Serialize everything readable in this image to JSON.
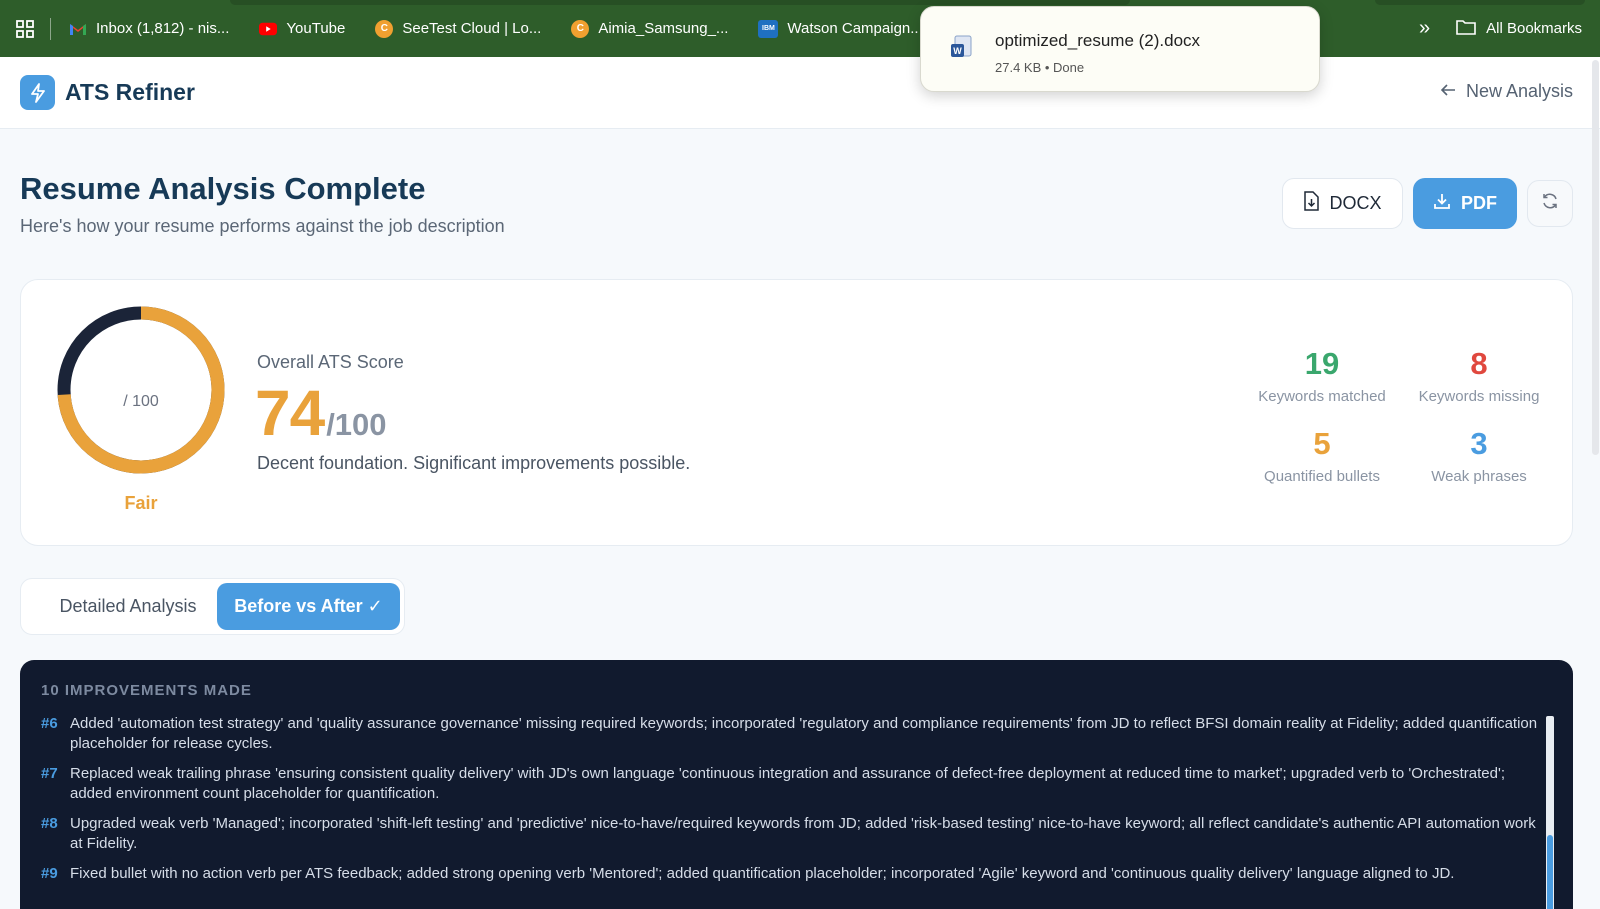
{
  "bookmarks": {
    "items": [
      {
        "label": "Inbox (1,812) - nis...",
        "icon": "gmail-icon",
        "color": "#ea4335"
      },
      {
        "label": "YouTube",
        "icon": "youtube-icon",
        "color": "#ff0000"
      },
      {
        "label": "SeeTest Cloud | Lo...",
        "icon": "seetest-icon",
        "color": "#f0a030"
      },
      {
        "label": "Aimia_Samsung_...",
        "icon": "aimia-icon",
        "color": "#f0a030"
      },
      {
        "label": "Watson Campaign...",
        "icon": "ibm-icon",
        "color": "#1f70c1"
      }
    ],
    "all_bookmarks": "All Bookmarks"
  },
  "download": {
    "filename": "optimized_resume (2).docx",
    "meta": "27.4 KB • Done"
  },
  "app": {
    "brand": "ATS Refiner",
    "new_analysis": "New Analysis"
  },
  "header": {
    "title": "Resume Analysis Complete",
    "subtitle": "Here's how your resume performs against the job description"
  },
  "actions": {
    "docx": "DOCX",
    "pdf": "PDF"
  },
  "score": {
    "label": "Overall ATS Score",
    "value": "74",
    "max": "/100",
    "fraction": 0.74,
    "gauge_center": "/ 100",
    "rating": "Fair",
    "description": "Decent foundation. Significant improvements possible.",
    "accent": "#e9a23b"
  },
  "stats": [
    {
      "value": "19",
      "label": "Keywords matched",
      "color": "#3aa76d"
    },
    {
      "value": "8",
      "label": "Keywords missing",
      "color": "#e0483e"
    },
    {
      "value": "5",
      "label": "Quantified bullets",
      "color": "#e9a23b"
    },
    {
      "value": "3",
      "label": "Weak phrases",
      "color": "#4a9ce0"
    }
  ],
  "tabs": {
    "detailed": "Detailed Analysis",
    "before_after": "Before vs After ✓"
  },
  "improvements": {
    "title": "10 IMPROVEMENTS MADE",
    "items": [
      {
        "index": "#6",
        "text": "Added 'automation test strategy' and 'quality assurance governance' missing required keywords; incorporated 'regulatory and compliance requirements' from JD to reflect BFSI domain reality at Fidelity; added quantification placeholder for release cycles."
      },
      {
        "index": "#7",
        "text": "Replaced weak trailing phrase 'ensuring consistent quality delivery' with JD's own language 'continuous integration and assurance of defect-free deployment at reduced time to market'; upgraded verb to 'Orchestrated'; added environment count placeholder for quantification."
      },
      {
        "index": "#8",
        "text": "Upgraded weak verb 'Managed'; incorporated 'shift-left testing' and 'predictive' nice-to-have/required keywords from JD; added 'risk-based testing' nice-to-have keyword; all reflect candidate's authentic API automation work at Fidelity."
      },
      {
        "index": "#9",
        "text": "Fixed bullet with no action verb per ATS feedback; added strong opening verb 'Mentored'; added quantification placeholder; incorporated 'Agile' keyword and 'continuous quality delivery' language aligned to JD."
      }
    ]
  }
}
